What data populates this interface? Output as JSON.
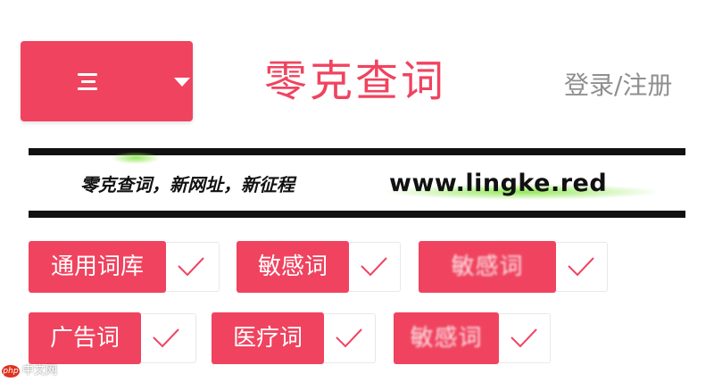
{
  "colors": {
    "accent": "#f0435f",
    "login_text": "#8f8f8f",
    "highlight_green": "#86e646",
    "watermark_red": "#e0311f"
  },
  "header": {
    "menu_icon": "hamburger-icon",
    "dropdown_icon": "caret-down-icon",
    "logo": "零克查词",
    "login_link": "登录/注册"
  },
  "banner": {
    "slogan": "零克查词，新网址，新征程",
    "url": "www.lingke.red"
  },
  "tags": [
    {
      "label": "通用词库",
      "checked": true,
      "icon": "checkmark-icon"
    },
    {
      "label": "敏感词",
      "checked": true,
      "icon": "checkmark-icon"
    },
    {
      "label": "敏感词",
      "checked": true,
      "icon": "checkmark-icon",
      "note": "text blurred in original"
    },
    {
      "label": "广告词",
      "checked": true,
      "icon": "checkmark-icon"
    },
    {
      "label": "医疗词",
      "checked": true,
      "icon": "checkmark-icon"
    },
    {
      "label": "敏感词",
      "checked": true,
      "icon": "checkmark-icon",
      "note": "text blurred in original"
    }
  ],
  "watermark": {
    "logo": "php",
    "text": "中文网"
  }
}
